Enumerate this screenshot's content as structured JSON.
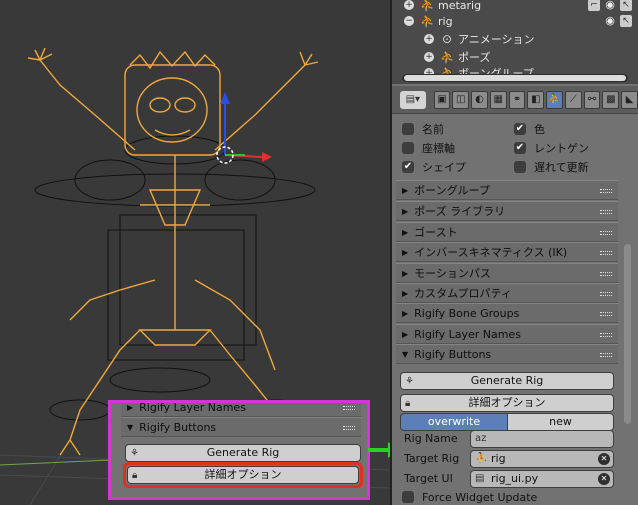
{
  "outliner": {
    "rows": [
      {
        "name": "metarig"
      },
      {
        "name": "rig"
      },
      {
        "name": "アニメーション"
      },
      {
        "name": "ポーズ"
      },
      {
        "name": "ボーングループ"
      }
    ]
  },
  "properties": {
    "checkboxes": [
      {
        "label": "名前",
        "checked": false
      },
      {
        "label": "色",
        "checked": true
      },
      {
        "label": "座標軸",
        "checked": false
      },
      {
        "label": "レントゲン",
        "checked": true
      },
      {
        "label": "シェイプ",
        "checked": true
      },
      {
        "label": "遅れて更新",
        "checked": false
      }
    ],
    "panels": [
      {
        "label": "ボーングループ"
      },
      {
        "label": "ポーズ ライブラリ"
      },
      {
        "label": "ゴースト"
      },
      {
        "label": "インバースキネマティクス (IK)"
      },
      {
        "label": "モーションパス"
      },
      {
        "label": "カスタムプロパティ"
      },
      {
        "label": "Rigify Bone Groups"
      },
      {
        "label": "Rigify Layer Names"
      },
      {
        "label": "Rigify Buttons"
      }
    ],
    "rigify": {
      "generate_label": "Generate Rig",
      "advanced_label": "詳細オプション",
      "overwrite_label": "overwrite",
      "new_label": "new",
      "rig_name_label": "Rig Name",
      "rig_name_value": "",
      "target_rig_label": "Target Rig",
      "target_rig_value": "rig",
      "target_ui_label": "Target UI",
      "target_ui_value": "rig_ui.py",
      "force_widget_label": "Force Widget Update"
    }
  },
  "callout": {
    "layer_names_label": "Rigify Layer Names",
    "buttons_label": "Rigify Buttons",
    "generate_label": "Generate Rig",
    "advanced_label": "詳細オプション"
  },
  "colors": {
    "rig_orange": "#f0a83a",
    "highlight_magenta": "#d237d2",
    "highlight_red": "#e0301e",
    "arrow_green": "#28d420",
    "toggle_blue": "#5b7fb6"
  }
}
